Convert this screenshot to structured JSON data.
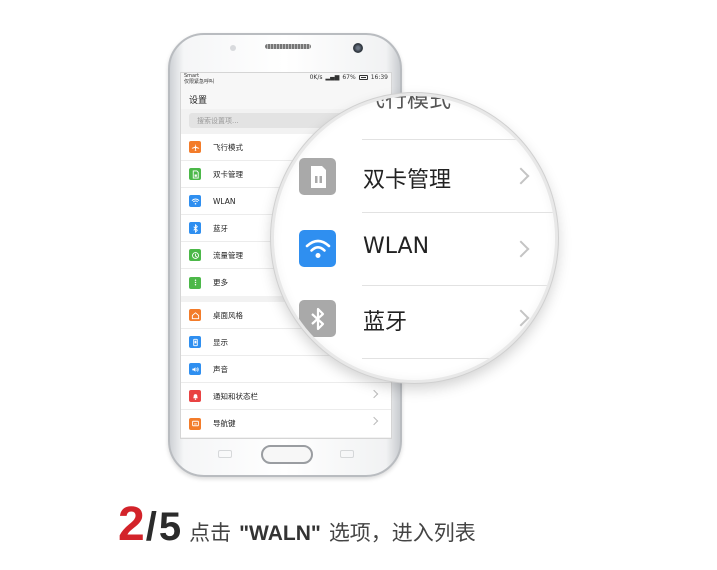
{
  "colors": {
    "accent": "#d3232a",
    "wifi_blue": "#2f8ff0"
  },
  "status": {
    "carrier_line1": "Smart",
    "carrier_line2": "仅限紧急呼叫",
    "speed": "0K/s",
    "battery": "67%",
    "time": "16:39"
  },
  "settings": {
    "title": "设置",
    "search_placeholder": "搜索设置项...",
    "group1": [
      {
        "label": "飞行模式",
        "icon": "airplane-icon",
        "color": "#f37c2a"
      },
      {
        "label": "双卡管理",
        "icon": "sim-card-icon",
        "color": "#4cb849"
      },
      {
        "label": "WLAN",
        "icon": "wifi-icon",
        "color": "#2f8ff0"
      },
      {
        "label": "蓝牙",
        "icon": "bluetooth-icon",
        "color": "#2f8ff0"
      },
      {
        "label": "流量管理",
        "icon": "data-usage-icon",
        "color": "#4cb849"
      },
      {
        "label": "更多",
        "icon": "more-icon",
        "color": "#4cb849"
      }
    ],
    "group2": [
      {
        "label": "桌面风格",
        "icon": "home-style-icon",
        "color": "#f37c2a"
      },
      {
        "label": "显示",
        "icon": "display-icon",
        "color": "#2f8ff0"
      },
      {
        "label": "声音",
        "icon": "sound-icon",
        "color": "#2f8ff0"
      },
      {
        "label": "通知和状态栏",
        "icon": "notification-icon",
        "color": "#e94343"
      },
      {
        "label": "导航键",
        "icon": "navigation-key-icon",
        "color": "#f37c2a"
      }
    ]
  },
  "magnifier": {
    "partial_label": "飞行模式",
    "items": [
      {
        "label": "双卡管理",
        "icon": "sim-card-icon",
        "color": "#a9a9a9"
      },
      {
        "label": "WLAN",
        "icon": "wifi-icon",
        "color": "#2f8ff0"
      },
      {
        "label": "蓝牙",
        "icon": "bluetooth-icon",
        "color": "#a9a9a9"
      }
    ]
  },
  "caption": {
    "step_current": "2",
    "slash": "/",
    "step_total": "5",
    "text_before": "点击",
    "highlight": "\"WALN\"",
    "text_after": "选项，进入列表"
  }
}
